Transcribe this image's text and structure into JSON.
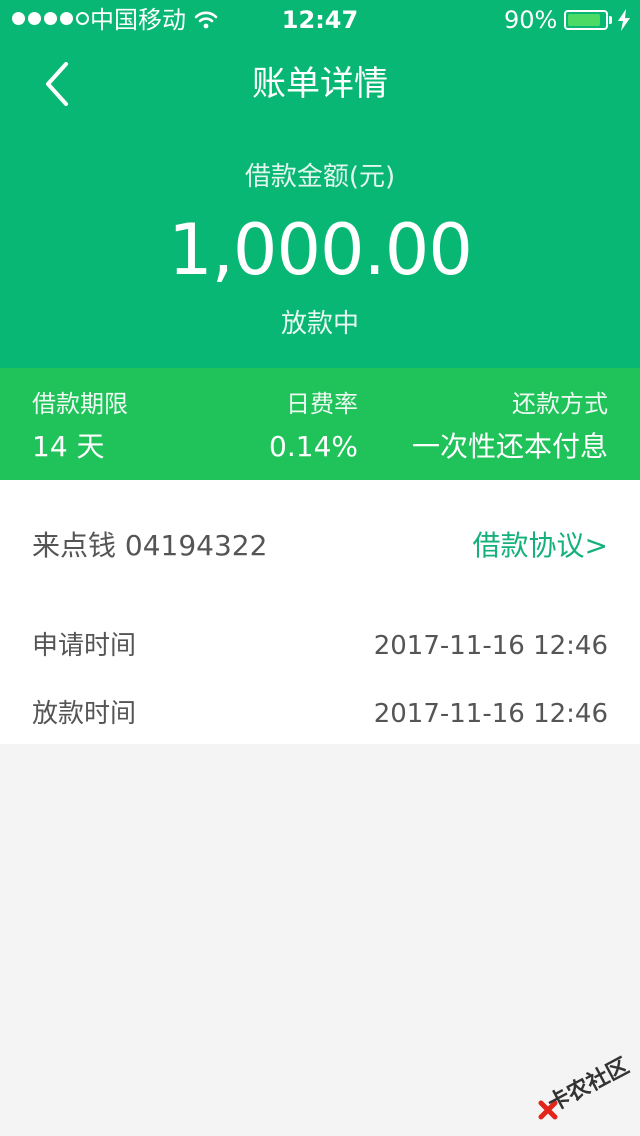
{
  "status_bar": {
    "carrier": "中国移动",
    "time": "12:47",
    "battery_percent": "90%",
    "battery_level": 0.9
  },
  "nav": {
    "title": "账单详情",
    "back_icon": "chevron-left-icon"
  },
  "summary": {
    "amount_label": "借款金额(元)",
    "amount": "1,000.00",
    "status": "放款中"
  },
  "stats": {
    "term_label": "借款期限",
    "term_value": "14 天",
    "rate_label": "日费率",
    "rate_value": "0.14%",
    "repay_label": "还款方式",
    "repay_value": "一次性还本付息"
  },
  "detail": {
    "order_no": "来点钱 04194322",
    "agreement_link": "借款协议>",
    "apply_time_label": "申请时间",
    "apply_time_value": "2017-11-16 12:46",
    "loan_time_label": "放款时间",
    "loan_time_value": "2017-11-16 12:46"
  },
  "watermark": {
    "text": "卡农社区"
  },
  "colors": {
    "header_green": "#09b774",
    "stats_green": "#1fc35a",
    "link_green": "#16b07a",
    "background": "#f4f4f4"
  }
}
